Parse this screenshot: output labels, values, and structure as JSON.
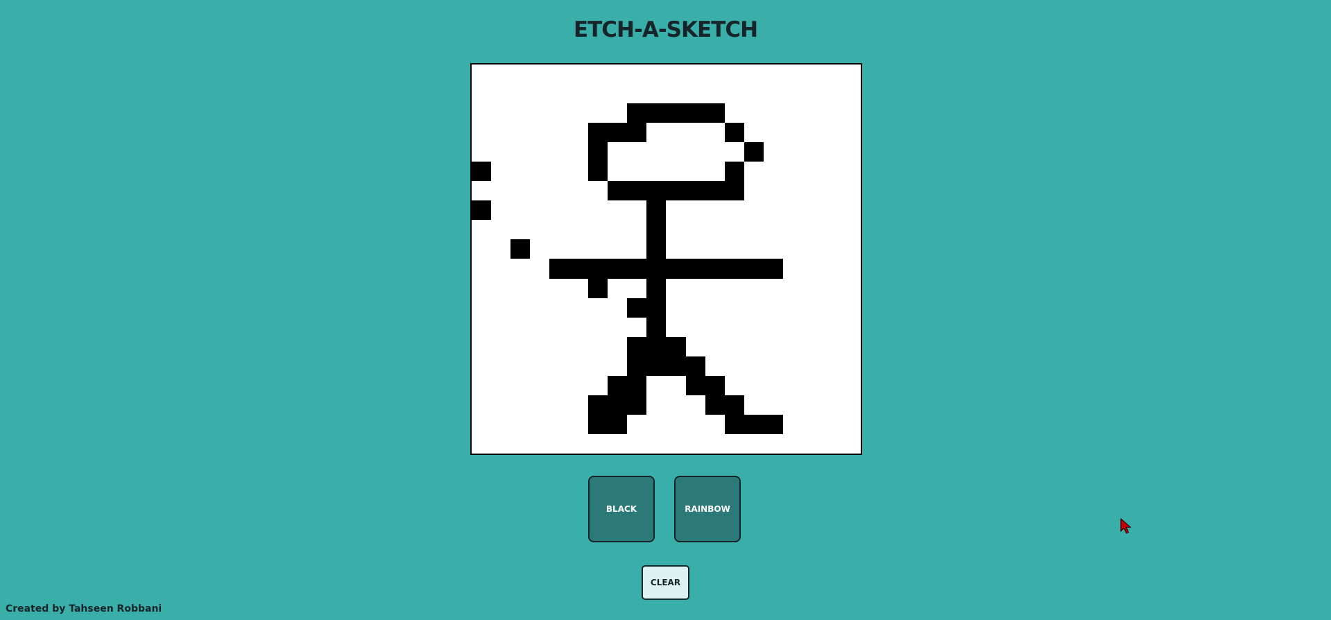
{
  "title": "ETCH-A-SKETCH",
  "board": {
    "grid_size": 20,
    "ink_color": "#000000",
    "paper_color": "#ffffff",
    "filled_cells": [
      [
        2,
        8
      ],
      [
        2,
        9
      ],
      [
        2,
        10
      ],
      [
        2,
        11
      ],
      [
        2,
        12
      ],
      [
        3,
        6
      ],
      [
        3,
        7
      ],
      [
        3,
        8
      ],
      [
        3,
        13
      ],
      [
        4,
        6
      ],
      [
        4,
        14
      ],
      [
        5,
        0
      ],
      [
        5,
        6
      ],
      [
        5,
        13
      ],
      [
        6,
        7
      ],
      [
        6,
        8
      ],
      [
        6,
        9
      ],
      [
        6,
        10
      ],
      [
        6,
        11
      ],
      [
        6,
        12
      ],
      [
        6,
        13
      ],
      [
        7,
        0
      ],
      [
        7,
        9
      ],
      [
        8,
        9
      ],
      [
        9,
        2
      ],
      [
        9,
        9
      ],
      [
        10,
        4
      ],
      [
        10,
        5
      ],
      [
        10,
        6
      ],
      [
        10,
        7
      ],
      [
        10,
        8
      ],
      [
        10,
        9
      ],
      [
        10,
        10
      ],
      [
        10,
        11
      ],
      [
        10,
        12
      ],
      [
        10,
        13
      ],
      [
        10,
        14
      ],
      [
        10,
        15
      ],
      [
        11,
        6
      ],
      [
        11,
        9
      ],
      [
        12,
        8
      ],
      [
        12,
        9
      ],
      [
        13,
        9
      ],
      [
        14,
        8
      ],
      [
        14,
        9
      ],
      [
        14,
        10
      ],
      [
        15,
        8
      ],
      [
        15,
        9
      ],
      [
        15,
        10
      ],
      [
        15,
        11
      ],
      [
        16,
        7
      ],
      [
        16,
        8
      ],
      [
        16,
        11
      ],
      [
        16,
        12
      ],
      [
        17,
        6
      ],
      [
        17,
        7
      ],
      [
        17,
        8
      ],
      [
        17,
        12
      ],
      [
        17,
        13
      ],
      [
        18,
        6
      ],
      [
        18,
        7
      ],
      [
        18,
        13
      ],
      [
        18,
        14
      ],
      [
        18,
        15
      ]
    ]
  },
  "buttons": {
    "black_label": "BLACK",
    "rainbow_label": "RAINBOW",
    "clear_label": "CLEAR"
  },
  "footer": {
    "credit": "Created by Tahseen Robbani"
  },
  "colors": {
    "background": "#3aafa9",
    "button_primary": "#2b7a78",
    "button_clear": "#def2f1",
    "text_dark": "#17252a"
  }
}
